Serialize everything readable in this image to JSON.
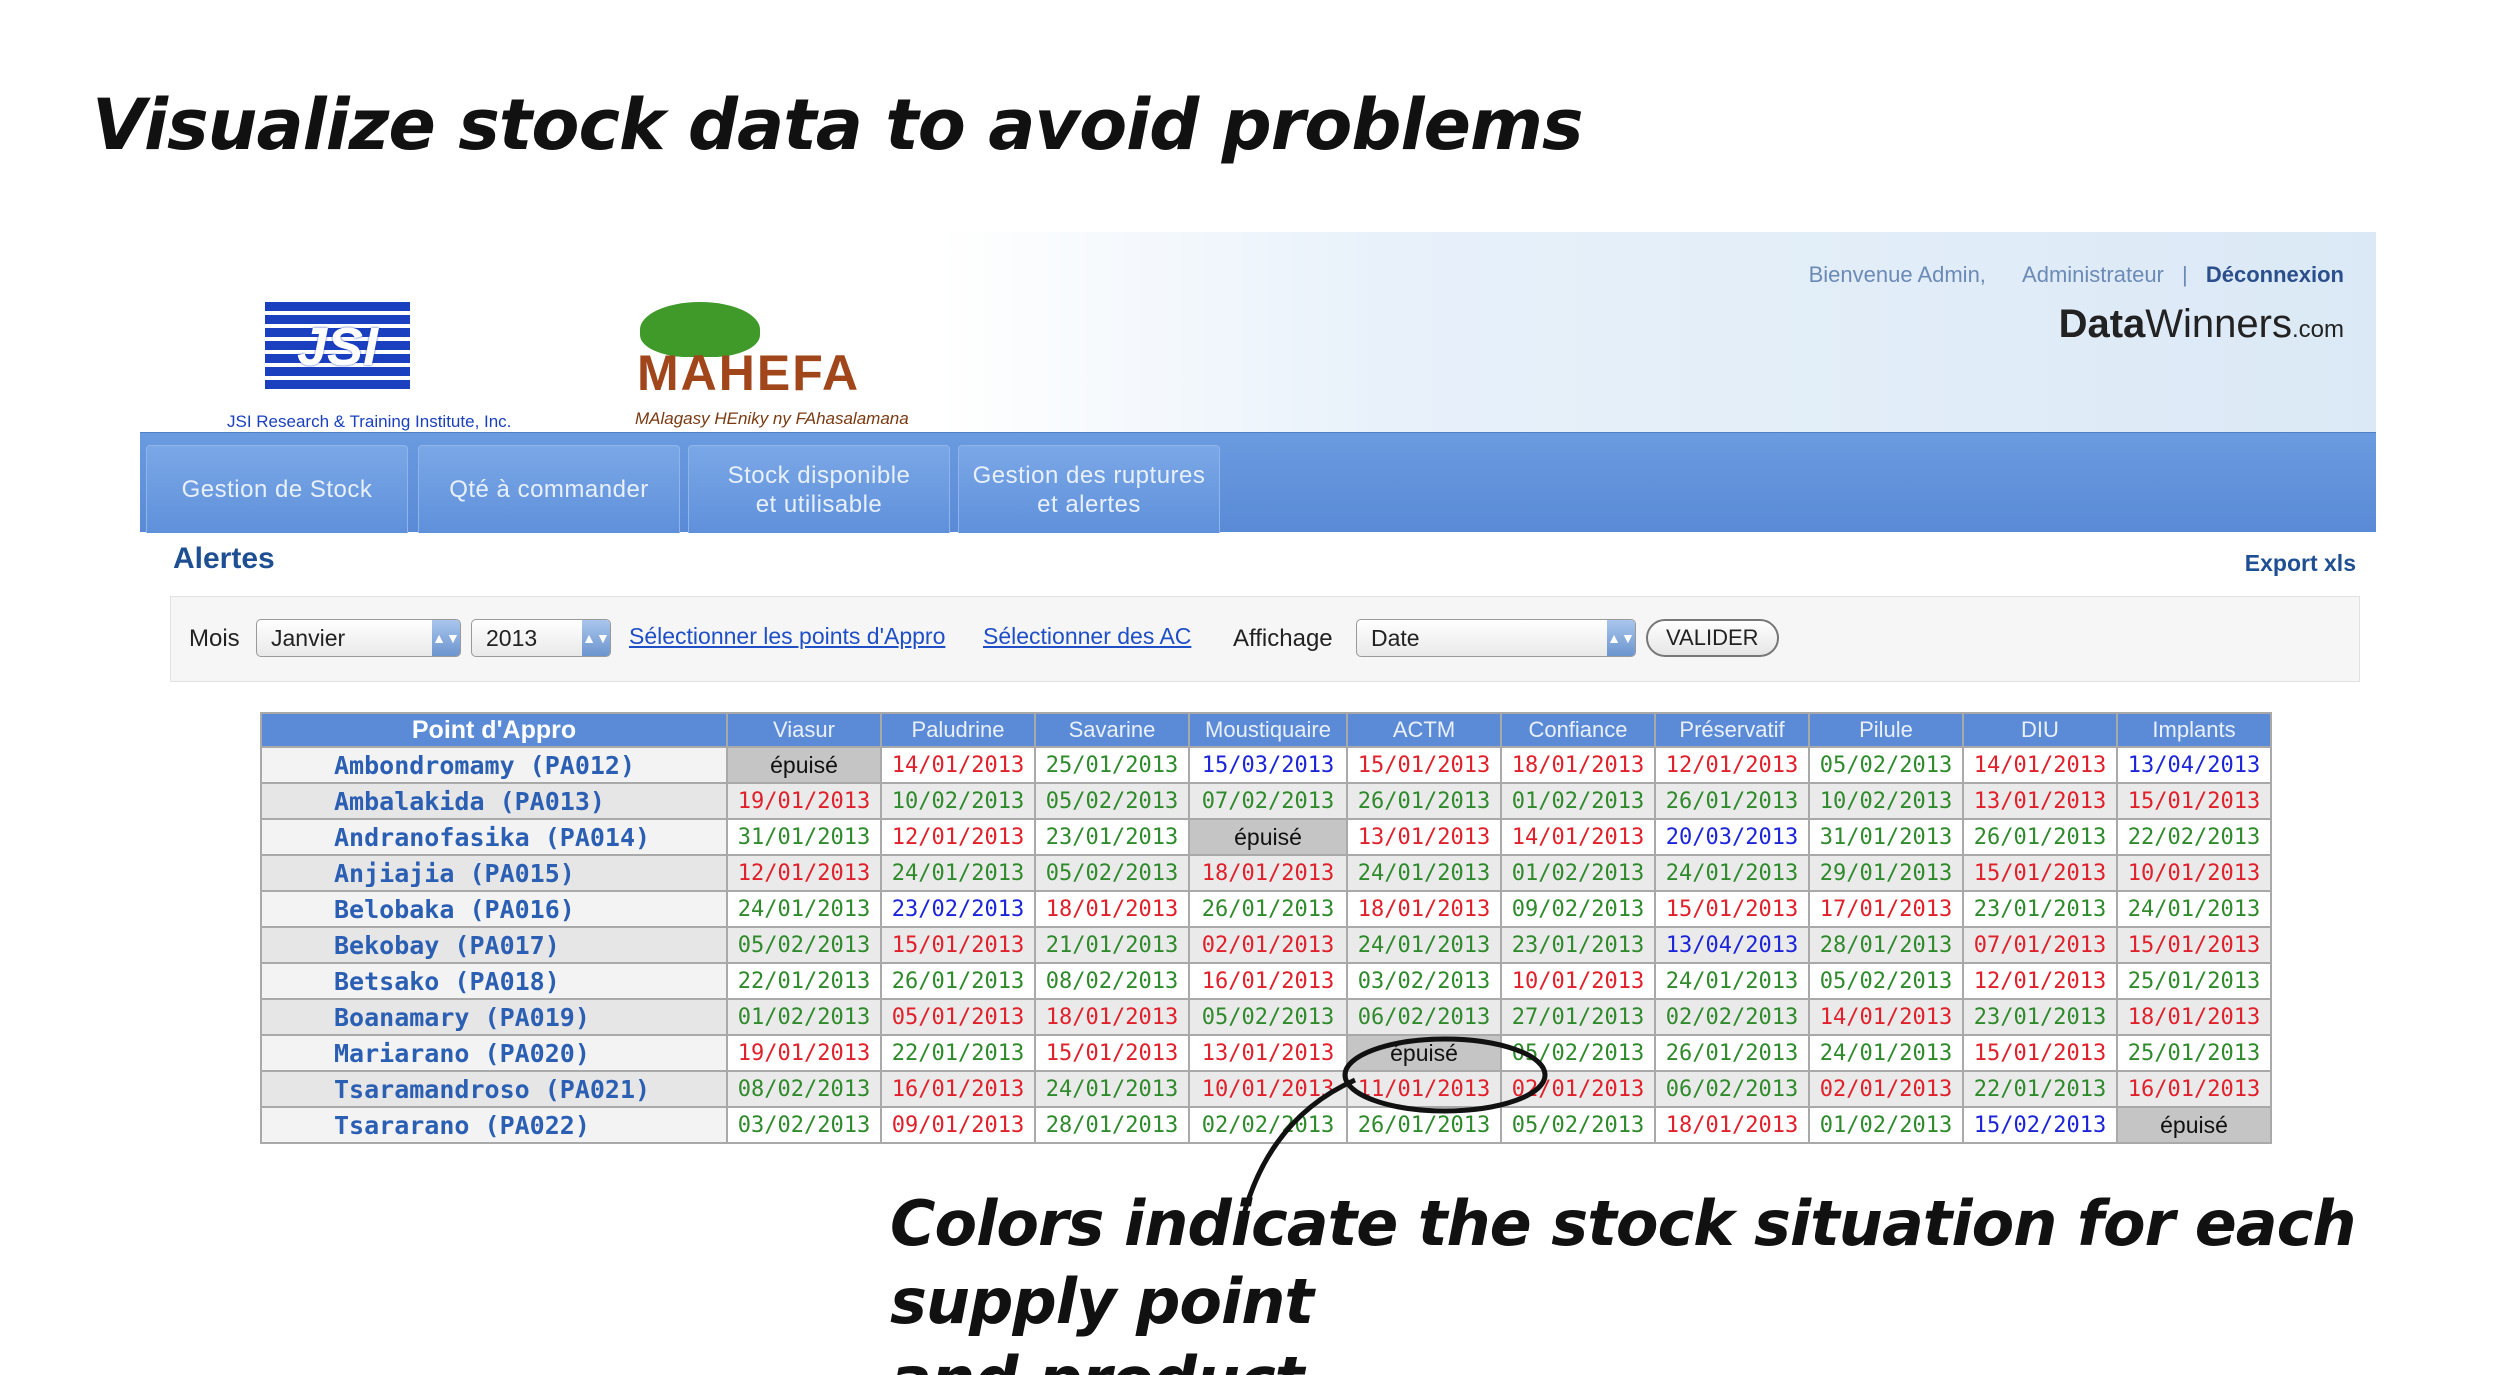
{
  "headline": "Visualize stock data to avoid problems",
  "caption": {
    "line1": "Colors indicate the stock situation for each supply point",
    "line2": "and product"
  },
  "colors": {
    "red": "#e0202a",
    "green": "#2f8a2c",
    "blue": "#1c24d9",
    "nav": "#5b8bd6"
  },
  "header": {
    "jsi_logo": "JSI",
    "jsi_sub": "JSI Research & Training Institute, Inc.",
    "mahefa_logo": "MAHEFA",
    "mahefa_sub": "MAlagasy HEniky ny FAhasalamana",
    "welcome": "Bienvenue Admin,",
    "role": "Administrateur",
    "separator": "|",
    "logout": "Déconnexion",
    "brand_data": "Data",
    "brand_winners": "Winners",
    "brand_com": ".com"
  },
  "nav": {
    "tabs": [
      {
        "label": "Gestion de Stock"
      },
      {
        "label": "Qté à commander"
      },
      {
        "label": "Stock disponible et utilisable"
      },
      {
        "label": "Gestion des ruptures et alertes"
      }
    ]
  },
  "page_title": "Alertes",
  "export_label": "Export xls",
  "filter": {
    "month_label": "Mois",
    "month_value": "Janvier",
    "year_value": "2013",
    "select_points_link": "Sélectionner les points d'Appro",
    "select_ac_link": "Sélectionner des AC",
    "display_label": "Affichage",
    "display_value": "Date",
    "submit_label": "VALIDER"
  },
  "table": {
    "columns": [
      "Point d'Appro",
      "Viasur",
      "Paludrine",
      "Savarine",
      "Moustiquaire",
      "ACTM",
      "Confiance",
      "Préservatif",
      "Pilule",
      "DIU",
      "Implants"
    ],
    "rows": [
      {
        "name": "Ambondromamy (PA012)",
        "cells": [
          [
            "épuisé",
            "e"
          ],
          [
            "14/01/2013",
            "r"
          ],
          [
            "25/01/2013",
            "g"
          ],
          [
            "15/03/2013",
            "b"
          ],
          [
            "15/01/2013",
            "r"
          ],
          [
            "18/01/2013",
            "r"
          ],
          [
            "12/01/2013",
            "r"
          ],
          [
            "05/02/2013",
            "g"
          ],
          [
            "14/01/2013",
            "r"
          ],
          [
            "13/04/2013",
            "b"
          ]
        ]
      },
      {
        "name": "Ambalakida (PA013)",
        "cells": [
          [
            "19/01/2013",
            "r"
          ],
          [
            "10/02/2013",
            "g"
          ],
          [
            "05/02/2013",
            "g"
          ],
          [
            "07/02/2013",
            "g"
          ],
          [
            "26/01/2013",
            "g"
          ],
          [
            "01/02/2013",
            "g"
          ],
          [
            "26/01/2013",
            "g"
          ],
          [
            "10/02/2013",
            "g"
          ],
          [
            "13/01/2013",
            "r"
          ],
          [
            "15/01/2013",
            "r"
          ]
        ]
      },
      {
        "name": "Andranofasika (PA014)",
        "cells": [
          [
            "31/01/2013",
            "g"
          ],
          [
            "12/01/2013",
            "r"
          ],
          [
            "23/01/2013",
            "g"
          ],
          [
            "épuisé",
            "e"
          ],
          [
            "13/01/2013",
            "r"
          ],
          [
            "14/01/2013",
            "r"
          ],
          [
            "20/03/2013",
            "b"
          ],
          [
            "31/01/2013",
            "g"
          ],
          [
            "26/01/2013",
            "g"
          ],
          [
            "22/02/2013",
            "g"
          ]
        ]
      },
      {
        "name": "Anjiajia (PA015)",
        "cells": [
          [
            "12/01/2013",
            "r"
          ],
          [
            "24/01/2013",
            "g"
          ],
          [
            "05/02/2013",
            "g"
          ],
          [
            "18/01/2013",
            "r"
          ],
          [
            "24/01/2013",
            "g"
          ],
          [
            "01/02/2013",
            "g"
          ],
          [
            "24/01/2013",
            "g"
          ],
          [
            "29/01/2013",
            "g"
          ],
          [
            "15/01/2013",
            "r"
          ],
          [
            "10/01/2013",
            "r"
          ]
        ]
      },
      {
        "name": "Belobaka (PA016)",
        "cells": [
          [
            "24/01/2013",
            "g"
          ],
          [
            "23/02/2013",
            "b"
          ],
          [
            "18/01/2013",
            "r"
          ],
          [
            "26/01/2013",
            "g"
          ],
          [
            "18/01/2013",
            "r"
          ],
          [
            "09/02/2013",
            "g"
          ],
          [
            "15/01/2013",
            "r"
          ],
          [
            "17/01/2013",
            "r"
          ],
          [
            "23/01/2013",
            "g"
          ],
          [
            "24/01/2013",
            "g"
          ]
        ]
      },
      {
        "name": "Bekobay (PA017)",
        "cells": [
          [
            "05/02/2013",
            "g"
          ],
          [
            "15/01/2013",
            "r"
          ],
          [
            "21/01/2013",
            "g"
          ],
          [
            "02/01/2013",
            "r"
          ],
          [
            "24/01/2013",
            "g"
          ],
          [
            "23/01/2013",
            "g"
          ],
          [
            "13/04/2013",
            "b"
          ],
          [
            "28/01/2013",
            "g"
          ],
          [
            "07/01/2013",
            "r"
          ],
          [
            "15/01/2013",
            "r"
          ]
        ]
      },
      {
        "name": "Betsako (PA018)",
        "cells": [
          [
            "22/01/2013",
            "g"
          ],
          [
            "26/01/2013",
            "g"
          ],
          [
            "08/02/2013",
            "g"
          ],
          [
            "16/01/2013",
            "r"
          ],
          [
            "03/02/2013",
            "g"
          ],
          [
            "10/01/2013",
            "r"
          ],
          [
            "24/01/2013",
            "g"
          ],
          [
            "05/02/2013",
            "g"
          ],
          [
            "12/01/2013",
            "r"
          ],
          [
            "25/01/2013",
            "g"
          ]
        ]
      },
      {
        "name": "Boanamary (PA019)",
        "cells": [
          [
            "01/02/2013",
            "g"
          ],
          [
            "05/01/2013",
            "r"
          ],
          [
            "18/01/2013",
            "r"
          ],
          [
            "05/02/2013",
            "g"
          ],
          [
            "06/02/2013",
            "g"
          ],
          [
            "27/01/2013",
            "g"
          ],
          [
            "02/02/2013",
            "g"
          ],
          [
            "14/01/2013",
            "r"
          ],
          [
            "23/01/2013",
            "g"
          ],
          [
            "18/01/2013",
            "r"
          ]
        ]
      },
      {
        "name": "Mariarano (PA020)",
        "cells": [
          [
            "19/01/2013",
            "r"
          ],
          [
            "22/01/2013",
            "g"
          ],
          [
            "15/01/2013",
            "r"
          ],
          [
            "13/01/2013",
            "r"
          ],
          [
            "épuisé",
            "e"
          ],
          [
            "05/02/2013",
            "g"
          ],
          [
            "26/01/2013",
            "g"
          ],
          [
            "24/01/2013",
            "g"
          ],
          [
            "15/01/2013",
            "r"
          ],
          [
            "25/01/2013",
            "g"
          ]
        ]
      },
      {
        "name": "Tsaramandroso (PA021)",
        "cells": [
          [
            "08/02/2013",
            "g"
          ],
          [
            "16/01/2013",
            "r"
          ],
          [
            "24/01/2013",
            "g"
          ],
          [
            "10/01/2013",
            "r"
          ],
          [
            "11/01/2013",
            "r"
          ],
          [
            "02/01/2013",
            "r"
          ],
          [
            "06/02/2013",
            "g"
          ],
          [
            "02/01/2013",
            "r"
          ],
          [
            "22/01/2013",
            "g"
          ],
          [
            "16/01/2013",
            "r"
          ]
        ]
      },
      {
        "name": "Tsararano (PA022)",
        "cells": [
          [
            "03/02/2013",
            "g"
          ],
          [
            "09/01/2013",
            "r"
          ],
          [
            "28/01/2013",
            "g"
          ],
          [
            "02/02/2013",
            "g"
          ],
          [
            "26/01/2013",
            "g"
          ],
          [
            "05/02/2013",
            "g"
          ],
          [
            "18/01/2013",
            "r"
          ],
          [
            "01/02/2013",
            "g"
          ],
          [
            "15/02/2013",
            "b"
          ],
          [
            "épuisé",
            "e"
          ]
        ]
      }
    ]
  }
}
